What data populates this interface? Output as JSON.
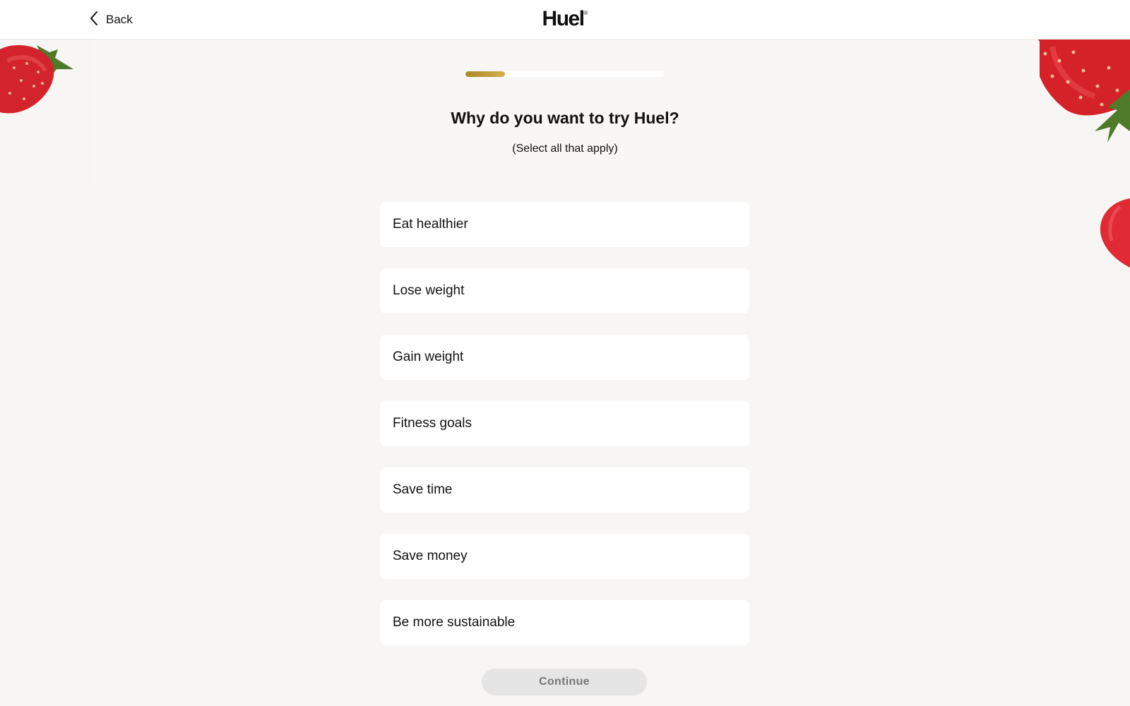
{
  "header": {
    "back_label": "Back",
    "brand": "Huel",
    "brand_mark": "®"
  },
  "progress": {
    "value": 0.2
  },
  "question": {
    "title": "Why do you want to try Huel?",
    "subtitle": "(Select all that apply)"
  },
  "options": [
    "Eat healthier",
    "Lose weight",
    "Gain weight",
    "Fitness goals",
    "Save time",
    "Save money",
    "Be more sustainable"
  ],
  "continue_label": "Continue",
  "colors": {
    "accent_gold": "#c2a03a",
    "background": "#f7f6f4",
    "option_bg": "#ffffff",
    "button_disabled": "#e5e5e5"
  },
  "icons": [
    "chevron-left-icon",
    "strawberry-decoration"
  ]
}
